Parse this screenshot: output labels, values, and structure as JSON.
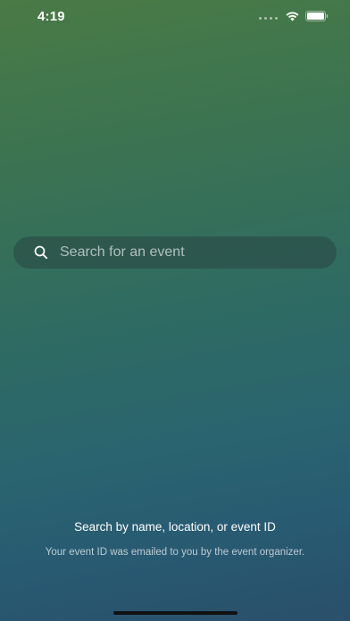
{
  "status_bar": {
    "time": "4:19",
    "icons": [
      "signal-dots-icon",
      "wifi-icon",
      "battery-icon"
    ]
  },
  "search": {
    "placeholder": "Search for an event",
    "value": "",
    "icon": "search-icon"
  },
  "hint": {
    "title": "Search by name, location, or event ID",
    "subtitle": "Your event ID was emailed to you by the event organizer."
  },
  "colors": {
    "gradient_top": "#4a7a45",
    "gradient_mid": "#2f6b62",
    "gradient_bottom": "#2a4f6a",
    "text": "#ffffff"
  }
}
